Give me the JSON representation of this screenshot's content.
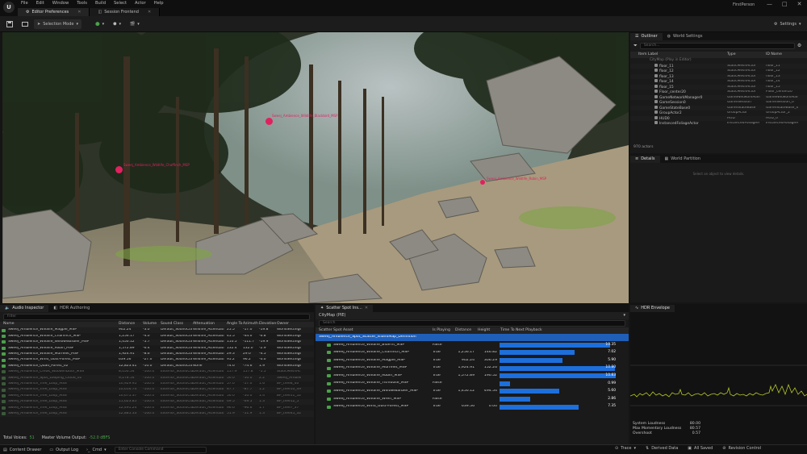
{
  "app": {
    "logo": "U",
    "menus": [
      "File",
      "Edit",
      "Window",
      "Tools",
      "Build",
      "Select",
      "Actor",
      "Help"
    ],
    "tabs": [
      "Editor Preferences",
      "Session Frontend"
    ],
    "project_name": "FirstPerson",
    "window_controls": [
      "—",
      "□",
      "✕"
    ]
  },
  "toolbar": {
    "selection_mode": "Selection Mode",
    "settings": "Settings"
  },
  "viewport": {
    "labels": [
      "Sweej_Ambience_Wildlife_Blackbird_MSP",
      "Sweej_Ambience_Wildlife_Chaffinch_MSP",
      "Sweej_Ambience_Wildlife_Robin_MSP"
    ]
  },
  "outliner": {
    "tabs": [
      "Outliner",
      "World Settings"
    ],
    "search_placeholder": "Search...",
    "columns": [
      "Item Label",
      "Type",
      "ID Name"
    ],
    "root": "CityMap (Play in Editor)",
    "rows": [
      {
        "label": "floor_11",
        "type": "StaticMeshActor",
        "id": "floor_11"
      },
      {
        "label": "floor_12",
        "type": "StaticMeshActor",
        "id": "floor_12"
      },
      {
        "label": "floor_13",
        "type": "StaticMeshActor",
        "id": "floor_13"
      },
      {
        "label": "floor_14",
        "type": "StaticMeshActor",
        "id": "floor_14"
      },
      {
        "label": "floor_15",
        "type": "StaticMeshActor",
        "id": "floor_15"
      },
      {
        "label": "Floor_center20",
        "type": "StaticMeshActor",
        "id": "Floor_center20"
      },
      {
        "label": "GameNetworkManager0",
        "type": "GameNetworkMan",
        "id": "GameNetworkMan"
      },
      {
        "label": "GameSession0",
        "type": "GameSession",
        "id": "GameSession_0"
      },
      {
        "label": "GameStateBase0",
        "type": "GameStateBase",
        "id": "GameStateBase_0"
      },
      {
        "label": "GroupActor2",
        "type": "GroupActor",
        "id": "GroupActor_2"
      },
      {
        "label": "HUD0",
        "type": "HUD",
        "id": "HUD_0"
      },
      {
        "label": "InstancedFoliageActor",
        "type": "InstancedFoliageA",
        "id": "InstancedFoliageA"
      }
    ],
    "actor_count": "970 actors"
  },
  "details": {
    "tabs": [
      "Details",
      "World Partition"
    ],
    "empty_message": "Select an object to view details."
  },
  "audio_inspector": {
    "tabs": [
      "Audio Inspector",
      "HDR Authoring"
    ],
    "filter_placeholder": "Filter",
    "columns": [
      "Name",
      "Distance",
      "Volume",
      "Sound Class",
      "Attenuation",
      "Angle To",
      "Azimuth",
      "Elevation",
      "Owner"
    ],
    "rows": [
      {
        "name": "Sweej_Ambience_Wildlife_Magpie_MSP",
        "dist": "902.24",
        "vol": "-3.0",
        "cls": "Default_SoundCla",
        "att": "Wildlife_Attenuati",
        "ang": "25.5",
        "az": "-17.0",
        "el": "-19.8",
        "own": "WorldSettings_1",
        "dim": false
      },
      {
        "name": "Sweej_Ambience_Wildlife_Chaffinch_MSP",
        "dist": "1,256.17",
        "vol": "-4.0",
        "cls": "Default_SoundCla",
        "att": "Wildlife_Attenuati",
        "ang": "45.5",
        "az": "-44.0",
        "el": "-6.8",
        "own": "WorldSettings_1",
        "dim": false
      },
      {
        "name": "Sweej_Ambience_Wildlife_WillowWarbler_MSP",
        "dist": "1,450.12",
        "vol": "-5.7",
        "cls": "Default_SoundCla",
        "att": "Wildlife_Attenuati",
        "ang": "110.5",
        "az": "-111.7",
        "el": "-19.9",
        "own": "WorldSettings_1",
        "dim": false
      },
      {
        "name": "Sweej_Ambience_Wildlife_Robin_MSP",
        "dist": "1,572.89",
        "vol": "-6.4",
        "cls": "Default_SoundCla",
        "att": "Wildlife_Attenuati",
        "ang": "132.4",
        "az": "132.0",
        "el": "-2.9",
        "own": "WorldSettings_1",
        "dim": false
      },
      {
        "name": "Sweej_Ambience_Wildlife_Murrelet_MSP",
        "dist": "1,924.91",
        "vol": "-8.6",
        "cls": "Default_SoundCla",
        "att": "Wildlife_Attenuati",
        "ang": "29.3",
        "az": "29.0",
        "el": "-4.5",
        "own": "WorldSettings_1",
        "dim": false
      },
      {
        "name": "Sweej_Ambience_Wind_Gust-Forest_MSP",
        "dist": "639.56",
        "vol": "-27.0",
        "cls": "Default_SoundCla",
        "att": "Wildlife_Attenuati",
        "ang": "95.2",
        "az": "96.2",
        "el": "-0.0",
        "own": "WorldSettings_1",
        "dim": false
      },
      {
        "name": "Sweej_Ambience_Quad_Forest_02",
        "dist": "12,823.41",
        "vol": "-10.0",
        "cls": "Default_SoundCla",
        "att": "None",
        "ang": "74.6",
        "az": "-74.6",
        "el": "1.9",
        "own": "WorldSettings_1",
        "dim": false
      },
      {
        "name": "Sweej_Ambience_Creak_WoodenDoor_MSS",
        "dist": "8,050.54",
        "vol": "-100.0",
        "cls": "Exterior_SoundCla",
        "att": "Default_Attenuati",
        "ang": "157.9",
        "az": "157.8",
        "el": "-5.5",
        "own": "StaticMeshActor",
        "dim": true
      },
      {
        "name": "Sweej_Ambience_Spot_Looping_Cloud_02",
        "dist": "9,278.54",
        "vol": "-100.0",
        "cls": "Exterior_SoundCla",
        "att": "Default_Attenuati",
        "ang": "50.0",
        "az": "-50.0",
        "el": "2.2",
        "own": "Sweej_Ambience_",
        "dim": true
      },
      {
        "name": "Sweej_Ambience_Tree_Loop_MSS",
        "dist": "10,929.95",
        "vol": "-100.0",
        "cls": "Exterior_SoundCla",
        "att": "Default_Attenuati",
        "ang": "57.0",
        "az": "-57.0",
        "el": "1.6",
        "own": "BP_tree8_40",
        "dim": true
      },
      {
        "name": "Sweej_Ambience_Tree_Loop_MSS",
        "dist": "10,616.74",
        "vol": "-100.0",
        "cls": "Exterior_SoundCla",
        "att": "Default_Attenuati",
        "ang": "87.7",
        "az": "-87.7",
        "el": "1.2",
        "own": "BP_tree10_49",
        "dim": true
      },
      {
        "name": "Sweej_Ambience_Tree_Loop_MSS",
        "dist": "10,675.37",
        "vol": "-100.0",
        "cls": "Exterior_SoundCla",
        "att": "Default_Attenuati",
        "ang": "50.0",
        "az": "-50.0",
        "el": "1.4",
        "own": "BP_tree11_52",
        "dim": true
      },
      {
        "name": "Sweej_Ambience_Tree_Loop_MSS",
        "dist": "11,623.85",
        "vol": "-100.0",
        "cls": "Exterior_SoundCla",
        "att": "Default_Attenuati",
        "ang": "69.5",
        "az": "-69.5",
        "el": "1.3",
        "own": "BP_tree12_5",
        "dim": true
      },
      {
        "name": "Sweej_Ambience_Tree_Loop_MSS",
        "dist": "12,491.24",
        "vol": "-100.0",
        "cls": "Exterior_SoundCla",
        "att": "Default_Attenuati",
        "ang": "96.6",
        "az": "-96.6",
        "el": "1.7",
        "own": "BP_tree7_37",
        "dim": true
      },
      {
        "name": "Sweej_Ambience_Tree_Loop_MSS",
        "dist": "12,885.33",
        "vol": "-100.0",
        "cls": "Exterior_SoundCla",
        "att": "Default_Attenuati",
        "ang": "51.9",
        "az": "-51.9",
        "el": "1.3",
        "own": "BP_tree45_32",
        "dim": true
      }
    ],
    "total_voices_label": "Total Voices:",
    "total_voices": "51",
    "master_volume_label": "Master Volume Output:",
    "master_volume": "-52.0 dBFS"
  },
  "scatter": {
    "tab": "Scatter Spot Ins...",
    "world": "CityMap (PIE)",
    "search_placeholder": "Search",
    "columns": [
      "Scatter Spot Asset",
      "Is Playing",
      "Distance",
      "Height",
      "Time To Next Playback"
    ],
    "parent": "Sweej_Ambience_Spot_Scatter_IslandMap_Definition",
    "max_time": 11.0,
    "rows": [
      {
        "name": "Sweej_Ambience_Wildlife_BlueTit_MSP",
        "playing": "False",
        "dist": "",
        "height": "",
        "time": "10.35",
        "t": 10.35
      },
      {
        "name": "Sweej_Ambience_Wildlife_Chaffinch_MSP",
        "playing": "True",
        "dist": "1,256.17",
        "height": "146.82",
        "time": "7.02",
        "t": 7.02
      },
      {
        "name": "Sweej_Ambience_Wildlife_Magpie_MSP",
        "playing": "True",
        "dist": "902.24",
        "height": "306.29",
        "time": "5.90",
        "t": 5.9
      },
      {
        "name": "Sweej_Ambience_Wildlife_Murrelet_MSP",
        "playing": "True",
        "dist": "1,924.91",
        "height": "152.26",
        "time": "10.80",
        "t": 10.8
      },
      {
        "name": "Sweej_Ambience_Wildlife_Robin_MSP",
        "playing": "True",
        "dist": "1,572.89",
        "height": "190.52",
        "time": "10.83",
        "t": 10.83
      },
      {
        "name": "Sweej_Ambience_Wildlife_Titmouse_MSP",
        "playing": "False",
        "dist": "",
        "height": "",
        "time": "0.99",
        "t": 0.99
      },
      {
        "name": "Sweej_Ambience_Wildlife_WillowWarbler_MSP",
        "playing": "True",
        "dist": "1,450.12",
        "height": "494.54",
        "time": "5.60",
        "t": 5.6
      },
      {
        "name": "Sweej_Ambience_Wildlife_Wren_MSP",
        "playing": "False",
        "dist": "",
        "height": "",
        "time": "2.86",
        "t": 2.86
      },
      {
        "name": "Sweej_Ambience_Wind_Gust-Forest_MSP",
        "playing": "True",
        "dist": "639.56",
        "height": "0.00",
        "time": "7.35",
        "t": 7.35
      }
    ]
  },
  "hdr": {
    "tab": "HDR Envelope",
    "stats": [
      {
        "label": "System Loudness",
        "value": "80.00"
      },
      {
        "label": "Max Momentary Loudness",
        "value": "80.57"
      },
      {
        "label": "Overshoot",
        "value": "0.57"
      }
    ]
  },
  "statusbar": {
    "content_drawer": "Content Drawer",
    "output_log": "Output Log",
    "cmd": "Cmd",
    "console_placeholder": "Enter Console Command",
    "trace": "Trace",
    "derived_data": "Derived Data",
    "all_saved": "All Saved",
    "revision_control": "Revision Control"
  },
  "colors": {
    "accent": "#1d6fdc",
    "selection": "#1f5fb8",
    "waveform": "#b7c72a",
    "marker": "#e0215f"
  }
}
